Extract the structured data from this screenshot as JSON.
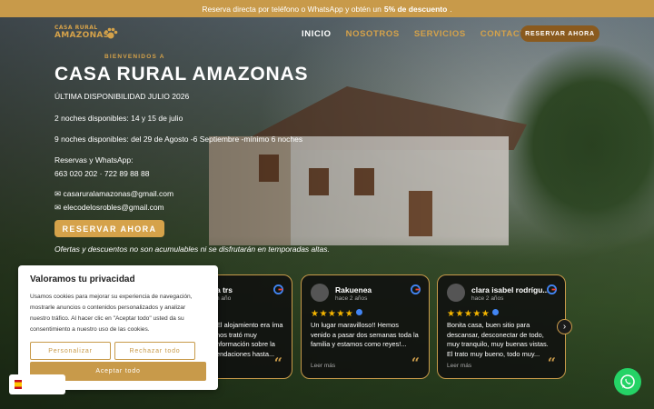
{
  "topbar": {
    "text_before": "Reserva directa por teléfono o WhatsApp y obtén un",
    "highlight": "5% de descuento",
    "text_after": "."
  },
  "brand": {
    "line1": "CASA RURAL",
    "line2": "AMAZONAS",
    "accent": "#d5a24a"
  },
  "nav": {
    "items": [
      {
        "label": "INICIO",
        "active": true
      },
      {
        "label": "NOSOTROS",
        "active": false
      },
      {
        "label": "SERVICIOS",
        "active": false
      },
      {
        "label": "CONTACTO",
        "active": false
      }
    ],
    "reserve_label": "RESERVAR AHORA"
  },
  "hero": {
    "eyebrow": "BIENVENIDOS A",
    "title": "CASA RURAL AMAZONAS",
    "availability_title": " ÚLTIMA DISPONIBILIDAD JULIO 2026 ",
    "line1": "2 noches disponibles: 14 y 15 de julio",
    "line2": "9 noches disponibles: del 29 de Agosto -6 Septiembre -mínimo 6 noches",
    "reservations_label": " Reservas y WhatsApp:",
    "phones": "663 020 202 · 722 89 88 88",
    "email1": "✉ casaruralamazonas@gmail.com",
    "email2": "✉ elecodelosrobles@gmail.com",
    "button": "RESERVAR AHORA",
    "note": "Ofertas y descuentos no son acumulables ni se disfrutarán en temporadas altas."
  },
  "reviews": [
    {
      "name": "a trs",
      "ago": "n año",
      "stars": "★★★★★",
      "text": "El alojamiento era íma nos trató muy nformación sobre la endaciones hasta...",
      "more": "",
      "quote": "“"
    },
    {
      "name": "Rakuenea",
      "ago": "hace 2 años",
      "stars": "★★★★★",
      "text": "Un lugar maravilloso!! Hemos venido a pasar dos semanas toda la familia y estamos como reyes!...",
      "more": "Leer más",
      "quote": "“"
    },
    {
      "name": "clara isabel rodrígu...",
      "ago": "hace 2 años",
      "stars": "★★★★★",
      "text": "Bonita casa, buen sitio para descansar, desconectar de todo, muy tranquilo, muy buenas vistas. El trato muy bueno, todo muy...",
      "more": "Leer más",
      "quote": "“"
    }
  ],
  "cookie": {
    "title": "Valoramos tu privacidad",
    "description": "Usamos cookies para mejorar su experiencia de navegación, mostrarle anuncios o contenidos personalizados y analizar nuestro tráfico. Al hacer clic en \"Aceptar todo\" usted da su consentimiento a nuestro uso de las cookies.",
    "customize": "Personalizar",
    "reject": "Rechazar todo",
    "accept": "Aceptar todo"
  },
  "icons": {
    "whatsapp": "whatsapp-icon",
    "next": "chevron-right-icon",
    "google": "google-icon",
    "paw": "paw-icon"
  },
  "colors": {
    "gold": "#c89a4a",
    "whatsapp": "#25d366"
  }
}
